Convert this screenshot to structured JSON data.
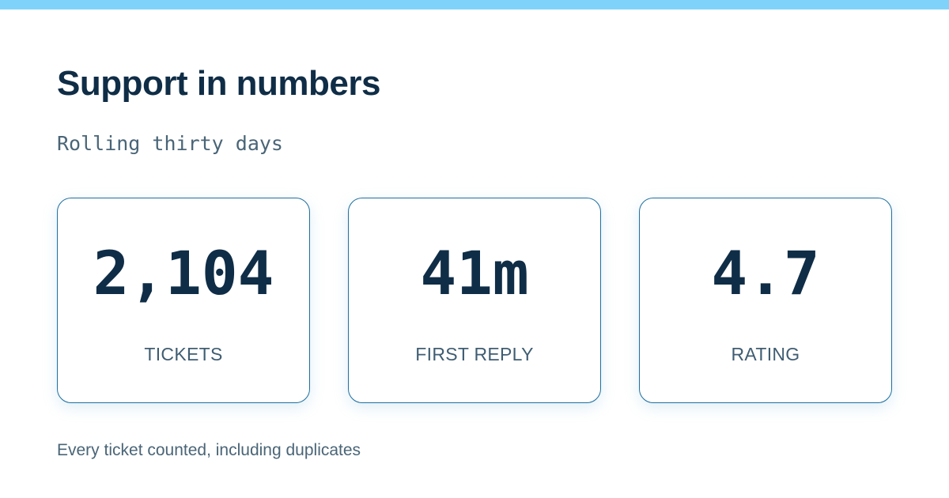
{
  "header": {
    "title": "Support in numbers",
    "subtitle": "Rolling thirty days"
  },
  "stats": [
    {
      "value": "2,104",
      "label": "TICKETS"
    },
    {
      "value": "41m",
      "label": "FIRST REPLY"
    },
    {
      "value": "4.7",
      "label": "RATING"
    }
  ],
  "footnote": "Every ticket counted, including duplicates",
  "colors": {
    "top_bar": "#7fd3fb",
    "title": "#0f2d46",
    "subtitle": "#4a6577",
    "card_border": "#1e6f9f",
    "value": "#0f2d46",
    "label": "#3f5d72",
    "footnote": "#4a6577"
  }
}
